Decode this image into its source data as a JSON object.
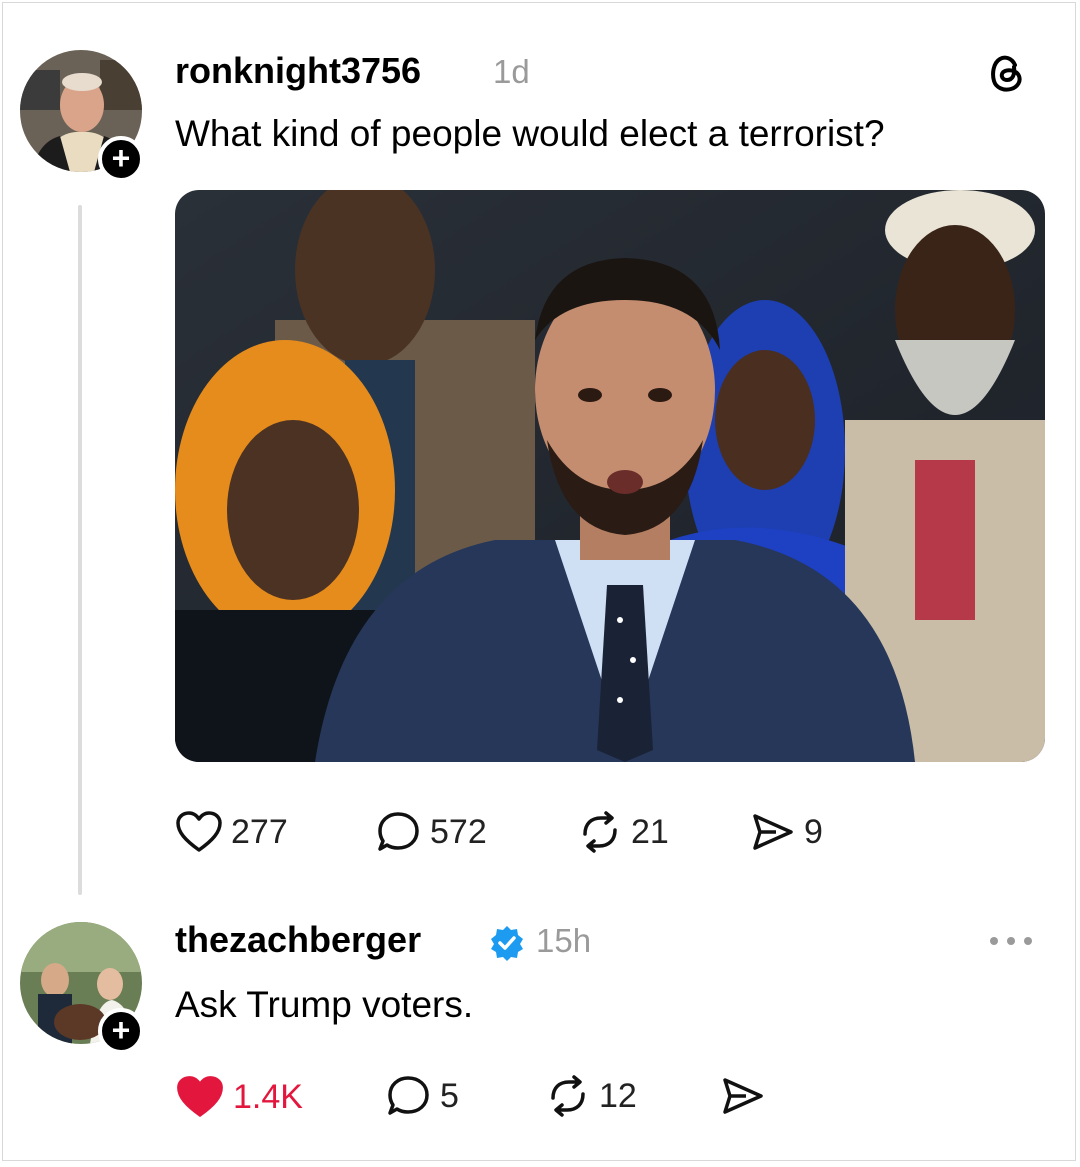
{
  "post": {
    "username": "ronknight3756",
    "time": "1d",
    "text": "What kind of people would elect a terrorist?",
    "actions": {
      "likes": "277",
      "replies": "572",
      "reposts": "21",
      "shares": "9"
    }
  },
  "reply": {
    "username": "thezachberger",
    "time": "15h",
    "text": "Ask Trump voters.",
    "actions": {
      "likes": "1.4K",
      "replies": "5",
      "reposts": "12"
    }
  },
  "colors": {
    "liked": "#e3173e",
    "verified": "#1d9bf0",
    "muted": "#9a9a9a"
  },
  "icons": [
    "threads-logo-icon",
    "plus-icon",
    "heart-icon",
    "comment-icon",
    "repost-icon",
    "share-icon",
    "verified-badge-icon",
    "more-icon"
  ]
}
